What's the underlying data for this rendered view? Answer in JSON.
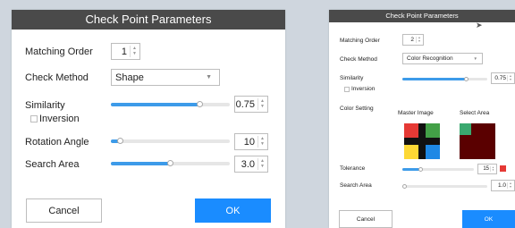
{
  "left": {
    "title": "Check Point Parameters",
    "matching_order": {
      "label": "Matching Order",
      "value": "1"
    },
    "check_method": {
      "label": "Check Method",
      "value": "Shape"
    },
    "similarity": {
      "label": "Similarity",
      "value": "0.75",
      "level": 0.75
    },
    "inversion": {
      "label": "Inversion",
      "checked": false
    },
    "rotation_angle": {
      "label": "Rotation Angle",
      "value": "10",
      "level": 0.08
    },
    "search_area": {
      "label": "Search Area",
      "value": "3.0",
      "level": 0.5
    },
    "cancel_label": "Cancel",
    "ok_label": "OK"
  },
  "right": {
    "title": "Check Point Parameters",
    "matching_order": {
      "label": "Matching Order",
      "value": "2"
    },
    "check_method": {
      "label": "Check Method",
      "value": "Color Recognition"
    },
    "similarity": {
      "label": "Similarity",
      "value": "0.75",
      "level": 0.75
    },
    "inversion": {
      "label": "Inversion",
      "checked": false
    },
    "color_setting": {
      "label": "Color Setting",
      "master_label": "Master Image",
      "select_label": "Select Area"
    },
    "tolerance": {
      "label": "Tolerance",
      "value": "15",
      "level": 0.25,
      "swatch_color": "#e53935"
    },
    "search_area": {
      "label": "Search Area",
      "value": "1.0",
      "level": 0.0
    },
    "cancel_label": "Cancel",
    "ok_label": "OK"
  },
  "colors": {
    "accent": "#1a8cff",
    "slider_fill": "#3d9be9",
    "title_bar": "#4a4a4a",
    "master_tl": "#e53935",
    "master_tr": "#43a047",
    "master_bl": "#fdd835",
    "master_br": "#1e88e5",
    "master_cross": "#111111",
    "select_dark": "#5a0000",
    "select_green": "#3aa86f"
  }
}
